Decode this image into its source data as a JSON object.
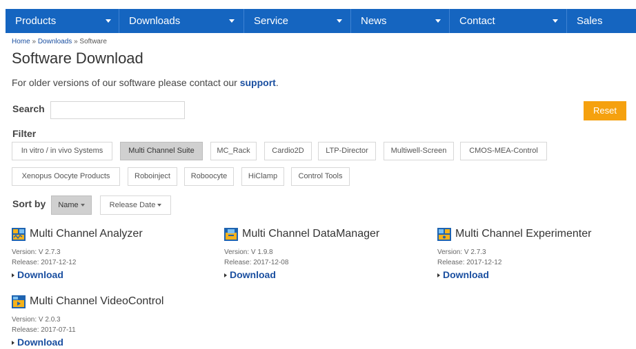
{
  "nav": {
    "items": [
      {
        "label": "Products",
        "has_caret": true
      },
      {
        "label": "Downloads",
        "has_caret": true
      },
      {
        "label": "Service",
        "has_caret": true
      },
      {
        "label": "News",
        "has_caret": true
      },
      {
        "label": "Contact",
        "has_caret": true
      },
      {
        "label": "Sales",
        "has_caret": false
      }
    ]
  },
  "breadcrumb": {
    "home": "Home",
    "sep": "»",
    "downloads": "Downloads",
    "current": "Software"
  },
  "page_title": "Software Download",
  "intro": {
    "text": "For older versions of our software please contact our ",
    "link": "support",
    "end": "."
  },
  "search": {
    "label": "Search",
    "value": "",
    "placeholder": ""
  },
  "reset_label": "Reset",
  "filter": {
    "label": "Filter",
    "chips": [
      {
        "label": "In vitro / in vivo Systems",
        "active": false
      },
      {
        "label": "Multi Channel Suite",
        "active": true
      },
      {
        "label": "MC_Rack",
        "active": false
      },
      {
        "label": "Cardio2D",
        "active": false
      },
      {
        "label": "LTP-Director",
        "active": false
      },
      {
        "label": "Multiwell-Screen",
        "active": false
      },
      {
        "label": "CMOS-MEA-Control",
        "active": false
      },
      {
        "label": "Xenopus Oocyte Products",
        "active": false
      },
      {
        "label": "Roboinject",
        "active": false
      },
      {
        "label": "Roboocyte",
        "active": false
      },
      {
        "label": "HiClamp",
        "active": false
      },
      {
        "label": "Control Tools",
        "active": false
      }
    ]
  },
  "sort": {
    "label": "Sort by",
    "options": [
      {
        "label": "Name",
        "active": true
      },
      {
        "label": "Release Date",
        "active": false
      }
    ]
  },
  "products": [
    {
      "name": "Multi Channel Analyzer",
      "version": "Version: V 2.7.3",
      "release": "Release: 2017-12-12",
      "download": "Download",
      "icon": "analyzer-icon"
    },
    {
      "name": "Multi Channel DataManager",
      "version": "Version: V 1.9.8",
      "release": "Release: 2017-12-08",
      "download": "Download",
      "icon": "datamanager-icon"
    },
    {
      "name": "Multi Channel Experimenter",
      "version": "Version: V 2.7.3",
      "release": "Release: 2017-12-12",
      "download": "Download",
      "icon": "experimenter-icon"
    },
    {
      "name": "Multi Channel VideoControl",
      "version": "Version: V 2.0.3",
      "release": "Release: 2017-07-11",
      "download": "Download",
      "icon": "videocontrol-icon"
    }
  ],
  "colors": {
    "nav_bg": "#1565c0",
    "link": "#1a4fa0",
    "reset_bg": "#f5a10f",
    "active_chip": "#d0d0d0"
  }
}
